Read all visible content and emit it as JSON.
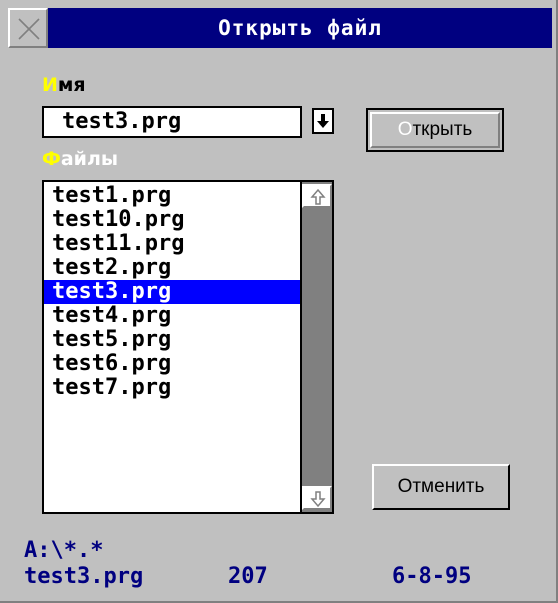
{
  "window": {
    "title": "Открыть файл"
  },
  "name_label": {
    "hot": "И",
    "rest": "мя"
  },
  "name_input": {
    "value": "test3.prg"
  },
  "files_label": {
    "hot": "Ф",
    "rest": "айлы"
  },
  "buttons": {
    "open": {
      "hot": "О",
      "rest": "ткрыть"
    },
    "cancel": "Отменить"
  },
  "files": [
    {
      "name": "test1.prg",
      "selected": false
    },
    {
      "name": "test10.prg",
      "selected": false
    },
    {
      "name": "test11.prg",
      "selected": false
    },
    {
      "name": "test2.prg",
      "selected": false
    },
    {
      "name": "test3.prg",
      "selected": true
    },
    {
      "name": "test4.prg",
      "selected": false
    },
    {
      "name": "test5.prg",
      "selected": false
    },
    {
      "name": "test6.prg",
      "selected": false
    },
    {
      "name": "test7.prg",
      "selected": false
    }
  ],
  "status": {
    "mask": "A:\\*.*",
    "file": "test3.prg",
    "size": "207",
    "date": "6-8-95"
  },
  "colors": {
    "title_bar": "#000080",
    "selection": "#0000ff",
    "hotkey": "#ffff00",
    "status_text": "#000080"
  },
  "icons": {
    "close": "close-icon",
    "dropdown": "arrow-down-icon",
    "scroll_up": "arrow-up-icon",
    "scroll_down": "arrow-down-icon"
  }
}
